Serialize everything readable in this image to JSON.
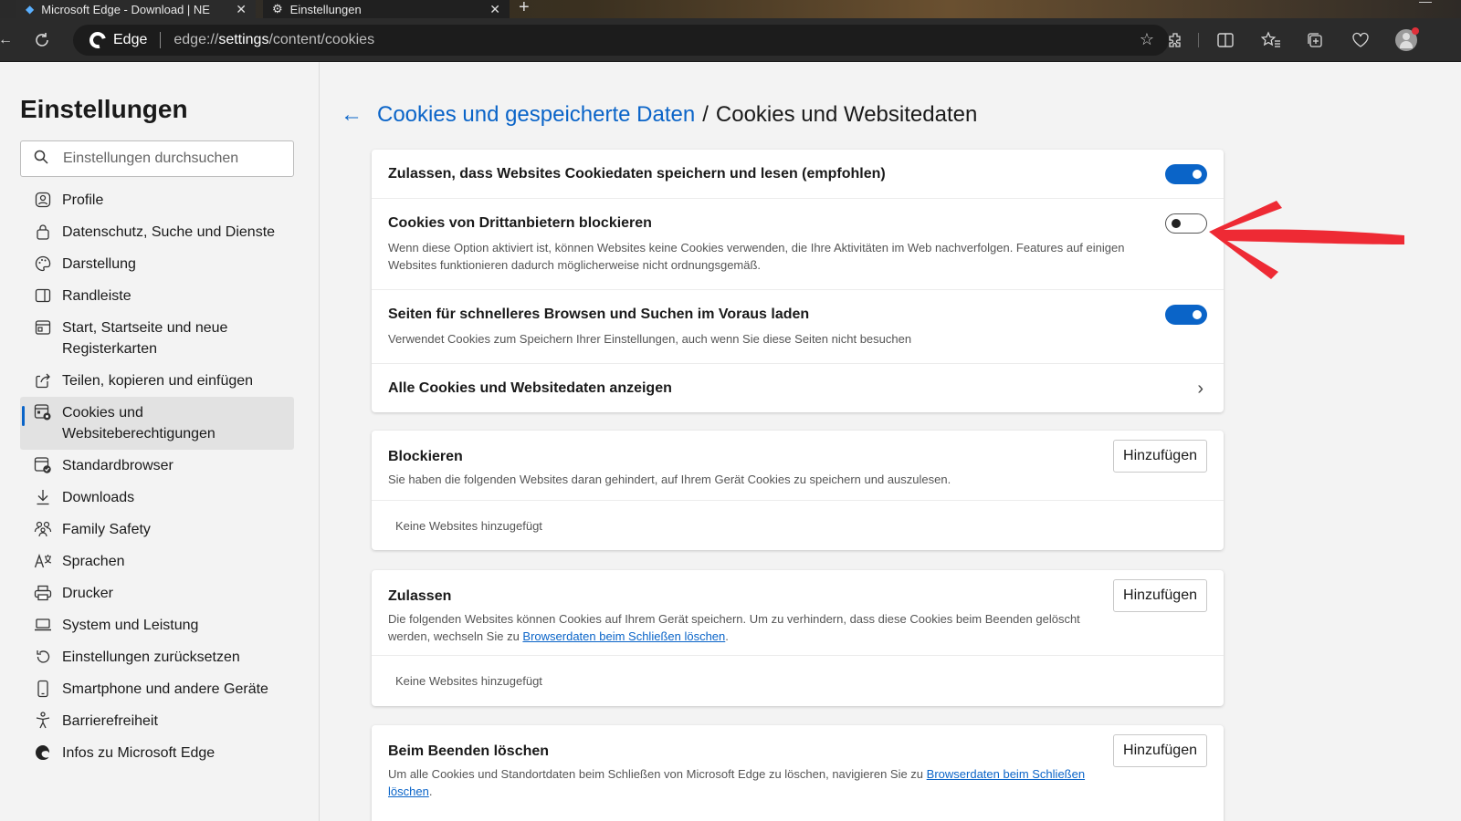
{
  "browser": {
    "tabs": [
      {
        "label": "Microsoft Edge - Download | NE",
        "close": "✕"
      },
      {
        "label": "Einstellungen",
        "close": "✕"
      }
    ],
    "new_tab": "+",
    "address": {
      "brand": "Edge",
      "url_prefix": "edge://",
      "url_strong": "settings",
      "url_suffix": "/content/cookies"
    }
  },
  "sidebar": {
    "title": "Einstellungen",
    "search_placeholder": "Einstellungen durchsuchen",
    "items": [
      {
        "label": "Profile",
        "icon": "profile-icon"
      },
      {
        "label": "Datenschutz, Suche und Dienste",
        "icon": "lock-icon"
      },
      {
        "label": "Darstellung",
        "icon": "palette-icon"
      },
      {
        "label": "Randleiste",
        "icon": "sidebar-panel-icon"
      },
      {
        "label": "Start, Startseite und neue Registerkarten",
        "icon": "home-tabs-icon"
      },
      {
        "label": "Teilen, kopieren und einfügen",
        "icon": "share-icon"
      },
      {
        "label": "Cookies und Websiteberechtigungen",
        "icon": "cookie-permissions-icon"
      },
      {
        "label": "Standardbrowser",
        "icon": "default-browser-icon"
      },
      {
        "label": "Downloads",
        "icon": "download-icon"
      },
      {
        "label": "Family Safety",
        "icon": "family-icon"
      },
      {
        "label": "Sprachen",
        "icon": "language-icon"
      },
      {
        "label": "Drucker",
        "icon": "printer-icon"
      },
      {
        "label": "System und Leistung",
        "icon": "laptop-icon"
      },
      {
        "label": "Einstellungen zurücksetzen",
        "icon": "reset-icon"
      },
      {
        "label": "Smartphone und andere Geräte",
        "icon": "phone-icon"
      },
      {
        "label": "Barrierefreiheit",
        "icon": "accessibility-icon"
      },
      {
        "label": "Infos zu Microsoft Edge",
        "icon": "edge-logo-icon"
      }
    ]
  },
  "main": {
    "breadcrumb_link": "Cookies und gespeicherte Daten",
    "breadcrumb_sep": "/",
    "breadcrumb_current": "Cookies und Websitedaten",
    "settings": {
      "allow": {
        "title": "Zulassen, dass Websites Cookiedaten speichern und lesen (empfohlen)",
        "on": true
      },
      "third_party": {
        "title": "Cookies von Drittanbietern blockieren",
        "desc": "Wenn diese Option aktiviert ist, können Websites keine Cookies verwenden, die Ihre Aktivitäten im Web nachverfolgen. Features auf einigen Websites funktionieren dadurch möglicherweise nicht ordnungsgemäß.",
        "on": false
      },
      "preload": {
        "title": "Seiten für schnelleres Browsen und Suchen im Voraus laden",
        "desc": "Verwendet Cookies zum Speichern Ihrer Einstellungen, auch wenn Sie diese Seiten nicht besuchen",
        "on": true
      },
      "all_cookies": {
        "title": "Alle Cookies und Websitedaten anzeigen"
      }
    },
    "block": {
      "title": "Blockieren",
      "desc": "Sie haben die folgenden Websites daran gehindert, auf Ihrem Gerät Cookies zu speichern und auszulesen.",
      "button": "Hinzufügen",
      "empty": "Keine Websites hinzugefügt"
    },
    "allow_list": {
      "title": "Zulassen",
      "desc": "Die folgenden Websites können Cookies auf Ihrem Gerät speichern. Um zu verhindern, dass diese Cookies beim Beenden gelöscht werden, wechseln Sie zu ",
      "link": "Browserdaten beim Schließen löschen",
      "desc_end": ".",
      "button": "Hinzufügen",
      "empty": "Keine Websites hinzugefügt"
    },
    "clear_on_exit": {
      "title": "Beim Beenden löschen",
      "desc": "Um alle Cookies und Standortdaten beim Schließen von Microsoft Edge zu löschen, navigieren Sie zu ",
      "link": "Browserdaten beim Schließen löschen",
      "desc_end": ".",
      "button": "Hinzufügen"
    }
  },
  "colors": {
    "accent": "#0a64c8",
    "annotation_arrow": "#ee2a34"
  }
}
